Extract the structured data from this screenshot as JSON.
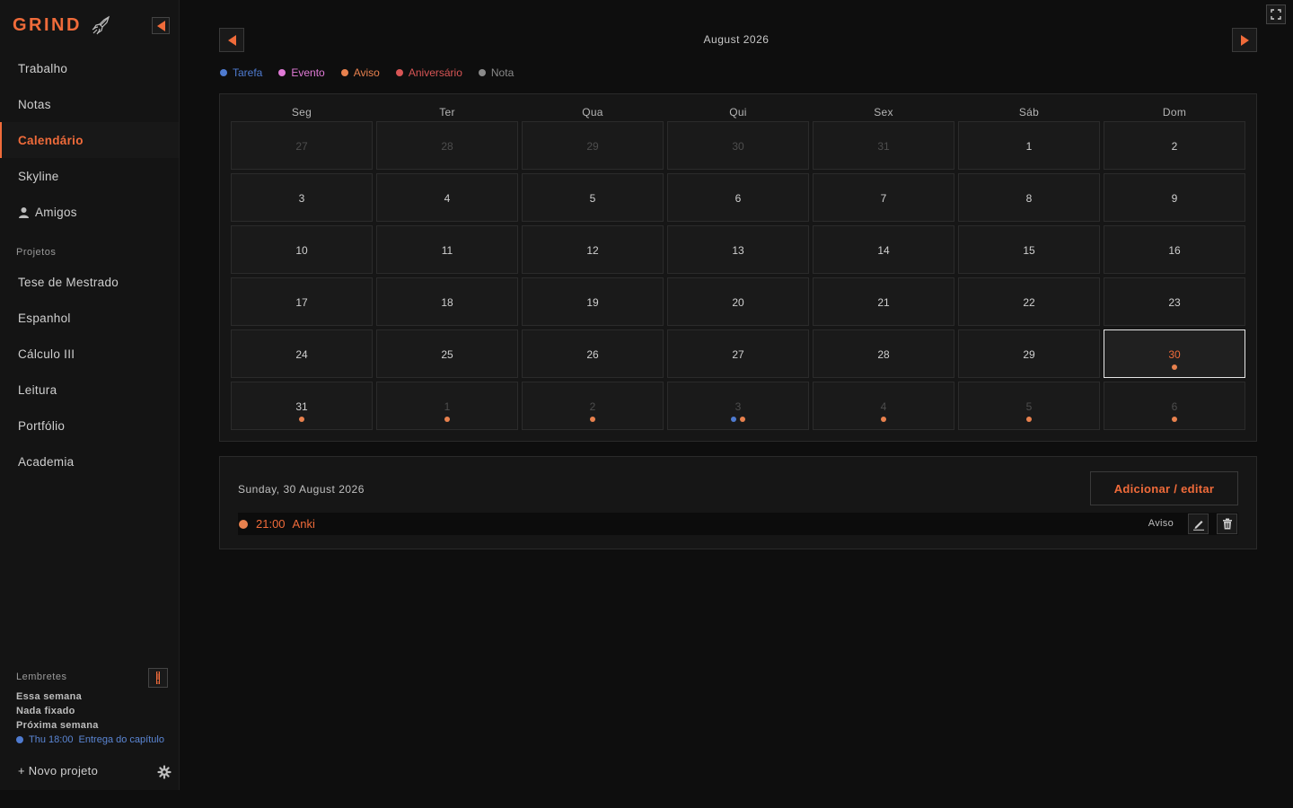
{
  "brand": {
    "name": "GRIND"
  },
  "colors": {
    "accent": "#f06b3a",
    "tarefa": "#4f7bd0",
    "evento": "#e07ad6",
    "aviso": "#e8814e",
    "aniversario": "#d85555",
    "nota": "#8a8a8a"
  },
  "sidebar": {
    "nav": [
      {
        "label": "Trabalho",
        "active": false
      },
      {
        "label": "Notas",
        "active": false
      },
      {
        "label": "Calendário",
        "active": true
      },
      {
        "label": "Skyline",
        "active": false
      },
      {
        "label": "Amigos",
        "active": false,
        "icon": "user-icon"
      }
    ],
    "projects_label": "Projetos",
    "projects": [
      "Tese de Mestrado",
      "Espanhol",
      "Cálculo III",
      "Leitura",
      "Portfólio",
      "Academia"
    ],
    "reminders": {
      "label": "Lembretes",
      "this_week": "Essa semana",
      "pinned": "Nada fixado",
      "next_week": "Próxima semana",
      "items": [
        {
          "time": "Thu 18:00",
          "text": "Entrega do capítulo",
          "color": "#4f7bd0"
        }
      ]
    },
    "new_project": "+ Novo projeto",
    "settings_icon": "gear-icon"
  },
  "calendar": {
    "month_title": "August 2026",
    "legend": [
      {
        "label": "Tarefa",
        "color": "#4f7bd0"
      },
      {
        "label": "Evento",
        "color": "#e07ad6"
      },
      {
        "label": "Aviso",
        "color": "#e8814e"
      },
      {
        "label": "Aniversário",
        "color": "#d85555"
      },
      {
        "label": "Nota",
        "color": "#8a8a8a"
      }
    ],
    "weekdays": [
      "Seg",
      "Ter",
      "Qua",
      "Qui",
      "Sex",
      "Sáb",
      "Dom"
    ],
    "weeks": [
      [
        {
          "d": "27",
          "o": true
        },
        {
          "d": "28",
          "o": true
        },
        {
          "d": "29",
          "o": true
        },
        {
          "d": "30",
          "o": true
        },
        {
          "d": "31",
          "o": true
        },
        {
          "d": "1"
        },
        {
          "d": "2"
        }
      ],
      [
        {
          "d": "3"
        },
        {
          "d": "4"
        },
        {
          "d": "5"
        },
        {
          "d": "6"
        },
        {
          "d": "7"
        },
        {
          "d": "8"
        },
        {
          "d": "9"
        }
      ],
      [
        {
          "d": "10"
        },
        {
          "d": "11"
        },
        {
          "d": "12"
        },
        {
          "d": "13"
        },
        {
          "d": "14"
        },
        {
          "d": "15"
        },
        {
          "d": "16"
        }
      ],
      [
        {
          "d": "17"
        },
        {
          "d": "18"
        },
        {
          "d": "19"
        },
        {
          "d": "20"
        },
        {
          "d": "21"
        },
        {
          "d": "22"
        },
        {
          "d": "23"
        }
      ],
      [
        {
          "d": "24"
        },
        {
          "d": "25"
        },
        {
          "d": "26"
        },
        {
          "d": "27"
        },
        {
          "d": "28"
        },
        {
          "d": "29"
        },
        {
          "d": "30",
          "sel": true,
          "dots": [
            "aviso"
          ]
        }
      ],
      [
        {
          "d": "31",
          "dots": [
            "aviso"
          ]
        },
        {
          "d": "1",
          "o": true,
          "dots": [
            "aviso"
          ]
        },
        {
          "d": "2",
          "o": true,
          "dots": [
            "aviso"
          ]
        },
        {
          "d": "3",
          "o": true,
          "dots": [
            "tarefa",
            "aviso"
          ]
        },
        {
          "d": "4",
          "o": true,
          "dots": [
            "aviso"
          ]
        },
        {
          "d": "5",
          "o": true,
          "dots": [
            "aviso"
          ]
        },
        {
          "d": "6",
          "o": true,
          "dots": [
            "aviso"
          ]
        }
      ]
    ]
  },
  "detail": {
    "date_label": "Sunday, 30 August 2026",
    "add_button": "Adicionar / editar",
    "events": [
      {
        "time": "21:00",
        "title": "Anki",
        "type": "Aviso",
        "color": "#e8814e"
      }
    ]
  }
}
